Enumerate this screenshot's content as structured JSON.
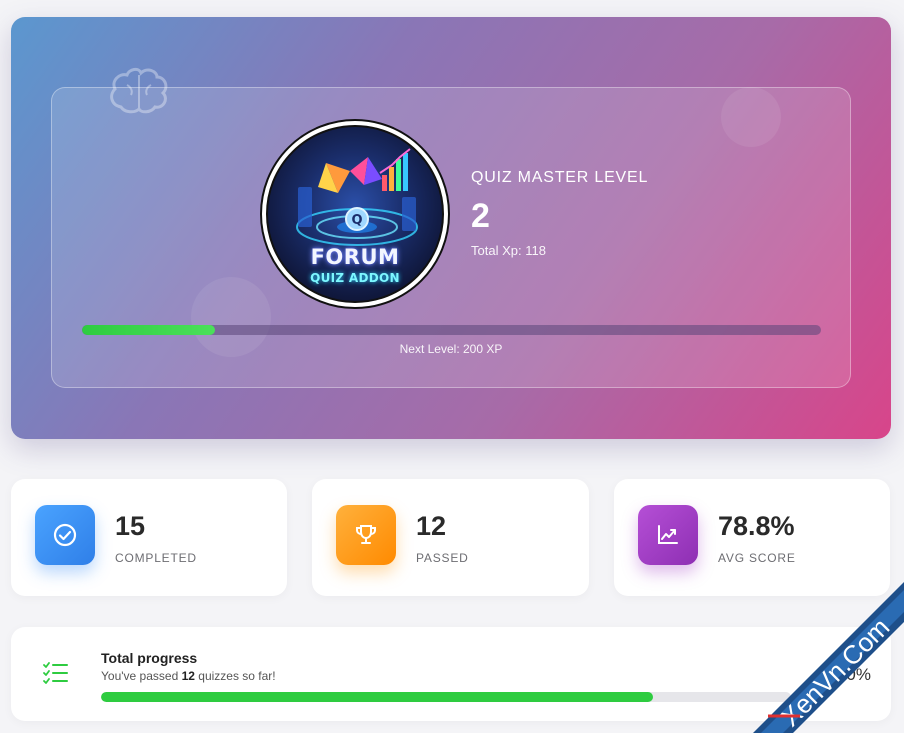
{
  "hero": {
    "level_label": "QUIZ MASTER LEVEL",
    "level_value": "2",
    "total_xp": "Total Xp: 118",
    "xp_progress_fraction": 0.18,
    "next_level": "Next Level: 200 XP",
    "logo": {
      "title": "FORUM",
      "subtitle": "QUIZ ADDON"
    },
    "decor_icon": "brain-icon"
  },
  "stats": [
    {
      "value": "15",
      "label": "COMPLETED",
      "icon": "check-circle-icon",
      "color": "#3d8ff5"
    },
    {
      "value": "12",
      "label": "PASSED",
      "icon": "trophy-icon",
      "color": "#ff9f1a"
    },
    {
      "value": "78.8%",
      "label": "AVG SCORE",
      "icon": "chart-line-icon",
      "color": "#a43fc7"
    }
  ],
  "progress": {
    "title": "Total progress",
    "sub_prefix": "You've passed ",
    "sub_count": "12",
    "sub_suffix": " quizzes so far!",
    "fraction": 0.8,
    "percent_label": "80%",
    "icon": "checklist-icon",
    "bar_color": "#2ecc40"
  },
  "watermark": {
    "text": "XenVn.Com"
  },
  "colors": {
    "accent_green": "#2ecc40",
    "hero_gradient_start": "#5b97cf",
    "hero_gradient_end": "#d8458a"
  }
}
